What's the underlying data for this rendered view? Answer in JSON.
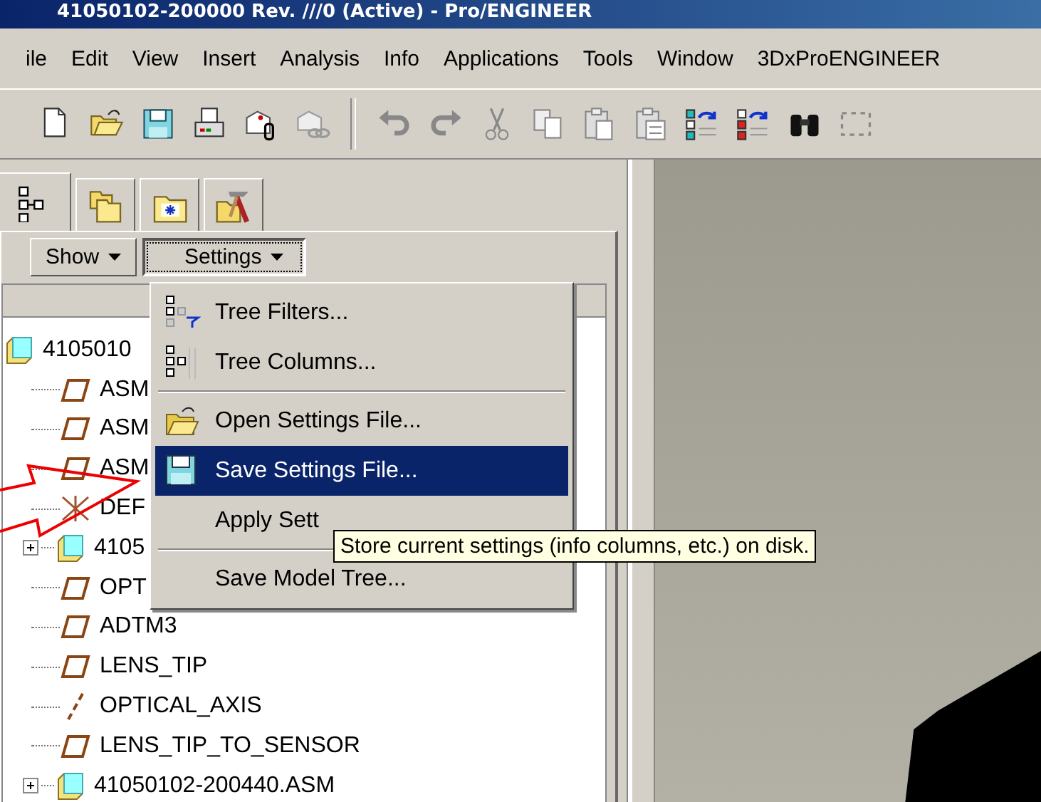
{
  "window": {
    "title": "41050102-200000 Rev. ///0 (Active) - Pro/ENGINEER"
  },
  "menu_bar": [
    "ile",
    "Edit",
    "View",
    "Insert",
    "Analysis",
    "Info",
    "Applications",
    "Tools",
    "Window",
    "3DxProENGINEER"
  ],
  "navigator_tabs": [
    {
      "selected": true
    },
    {
      "selected": false
    },
    {
      "selected": false
    },
    {
      "selected": false
    }
  ],
  "tree_buttons": [
    {
      "label": "Show",
      "selected": false
    },
    {
      "label": "Settings",
      "selected": true
    }
  ],
  "model_tree": {
    "label": "4105010",
    "kind": "assembly",
    "children": [
      {
        "label": "ASM",
        "kind": "plane"
      },
      {
        "label": "ASM",
        "kind": "plane"
      },
      {
        "label": "ASM",
        "kind": "plane"
      },
      {
        "label": "DEF",
        "kind": "csys"
      },
      {
        "label": "4105",
        "kind": "assembly",
        "expanded": false
      },
      {
        "label": "OPT",
        "kind": "plane"
      },
      {
        "label": "ADTM3",
        "kind": "plane"
      },
      {
        "label": "LENS_TIP",
        "kind": "plane"
      },
      {
        "label": "OPTICAL_AXIS",
        "kind": "axis"
      },
      {
        "label": "LENS_TIP_TO_SENSOR",
        "kind": "plane"
      },
      {
        "label": "41050102-200440.ASM",
        "kind": "assembly",
        "expanded": false
      }
    ]
  },
  "settings_menu": {
    "groups": [
      [
        {
          "label": "Tree Filters...",
          "selected": false
        },
        {
          "label": "Tree Columns...",
          "selected": false
        }
      ],
      [
        {
          "label": "Open Settings File...",
          "selected": false
        },
        {
          "label": "Save Settings File...",
          "selected": true
        },
        {
          "label": "Apply Sett",
          "selected": false
        }
      ],
      [
        {
          "label": "Save Model Tree...",
          "selected": false
        }
      ]
    ]
  },
  "tooltip": {
    "text": "Store current settings (info columns, etc.) on disk."
  }
}
